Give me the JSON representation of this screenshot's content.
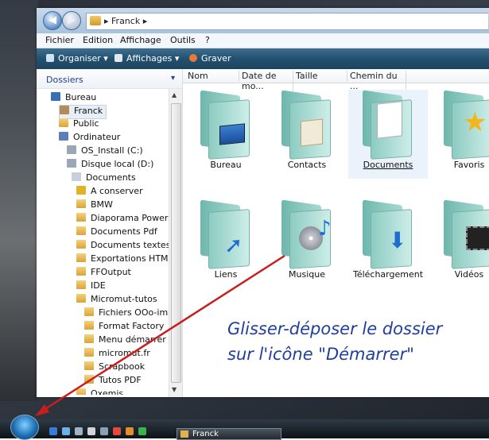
{
  "address": {
    "breadcrumb": "▸  Franck  ▸"
  },
  "menu": [
    "Fichier",
    "Edition",
    "Affichage",
    "Outils",
    "?"
  ],
  "toolbar": {
    "organize": "Organiser ▾",
    "views": "Affichages ▾",
    "burn": "Graver"
  },
  "nav": {
    "header": "Dossiers",
    "items": [
      "Bureau",
      "Franck",
      "Public",
      "Ordinateur",
      "OS_Install (C:)",
      "Disque local (D:)",
      "Documents",
      "A conserver",
      "BMW",
      "Diaporama Powerpoi",
      "Documents Pdf",
      "Documents textes",
      "Exportations HTML",
      "FFOutput",
      "IDE",
      "Micromut-tutos",
      "Fichiers OOo-image",
      "Format Factory",
      "Menu démarrer",
      "micromut.fr",
      "Scrapbook",
      "Tutos PDF",
      "Oxemis"
    ]
  },
  "columns": [
    "Nom",
    "Date de mo...",
    "Taille",
    "Chemin du ..."
  ],
  "items": [
    "Bureau",
    "Contacts",
    "Documents",
    "Favoris",
    "Liens",
    "Musique",
    "Téléchargement",
    "Vidéos"
  ],
  "annotation": {
    "line1": "Glisser-déposer le dossier",
    "line2": "sur l'icône \"Démarrer\""
  },
  "taskbar": {
    "window": "Franck"
  },
  "colors": {
    "annotation": "#1f3f9f",
    "arrow": "#c81e1e",
    "toolbar": "#23506f"
  }
}
